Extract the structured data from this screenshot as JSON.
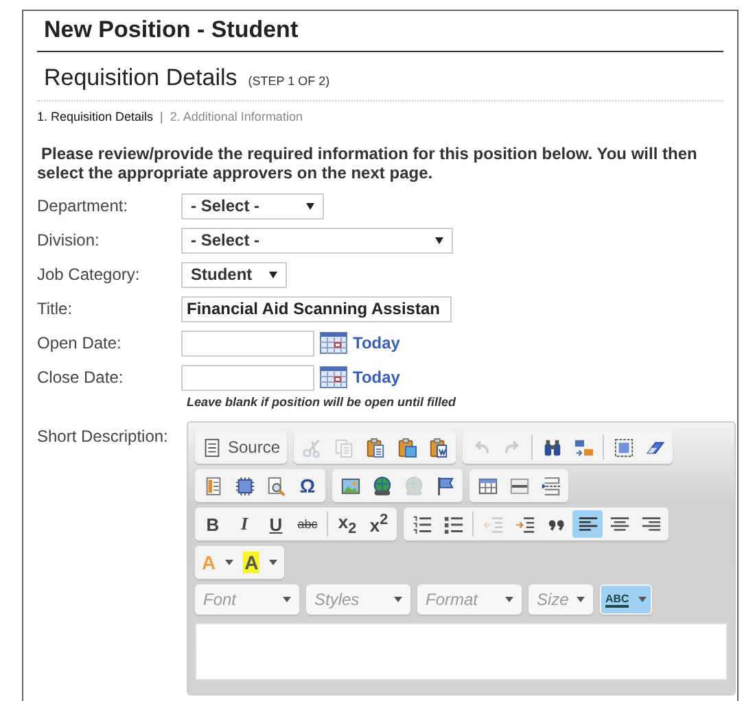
{
  "page_title": "New Position - Student",
  "section": {
    "title": "Requisition Details",
    "step": "(STEP 1 OF 2)"
  },
  "steps": [
    {
      "label": "1. Requisition Details",
      "selected": true
    },
    {
      "label": "2. Additional Information",
      "selected": false
    }
  ],
  "step_separator": "|",
  "instructions": "Please review/provide the required information for this position below. You will then select the appropriate approvers on the next page.",
  "fields": [
    {
      "kind": "select",
      "label": "Department:",
      "value": "- Select -"
    },
    {
      "kind": "select",
      "label": "Division:",
      "value": "- Select -"
    },
    {
      "kind": "select",
      "label": "Job Category:",
      "value": "Student"
    },
    {
      "kind": "text",
      "label": "Title:",
      "value": "Financial Aid Scanning Assistan"
    },
    {
      "kind": "date",
      "label": "Open Date:",
      "link": "Today"
    },
    {
      "kind": "date",
      "label": "Close Date:",
      "link": "Today",
      "hint": "Leave blank if position will be open until filled"
    }
  ],
  "editor_label": "Short Description:",
  "toolbar": [
    [
      [
        {
          "kind": "button",
          "label": "Source",
          "disabled": false,
          "selected": false
        }
      ],
      [
        {
          "kind": "button",
          "disabled": true,
          "selected": false
        },
        {
          "kind": "button",
          "disabled": true,
          "selected": false
        },
        {
          "kind": "button",
          "disabled": false,
          "selected": false
        },
        {
          "kind": "button",
          "disabled": false,
          "selected": false
        },
        {
          "kind": "button",
          "disabled": false,
          "selected": false
        }
      ],
      [
        {
          "kind": "button",
          "disabled": true,
          "selected": false
        },
        {
          "kind": "button",
          "disabled": true,
          "selected": false
        },
        {
          "kind": "button",
          "disabled": false,
          "selected": false,
          "divider": true
        },
        {
          "kind": "button",
          "disabled": false,
          "selected": false
        },
        {
          "kind": "button",
          "disabled": false,
          "selected": false,
          "divider": true
        },
        {
          "kind": "button",
          "disabled": false,
          "selected": false
        }
      ]
    ],
    [
      [
        {
          "kind": "button",
          "disabled": false,
          "selected": false
        },
        {
          "kind": "button",
          "disabled": false,
          "selected": false
        },
        {
          "kind": "button",
          "disabled": false,
          "selected": false
        },
        {
          "kind": "button",
          "label": "Ω",
          "disabled": false,
          "selected": false
        }
      ],
      [
        {
          "kind": "button",
          "disabled": false,
          "selected": false
        },
        {
          "kind": "button",
          "disabled": false,
          "selected": false
        },
        {
          "kind": "button",
          "disabled": true,
          "selected": false
        },
        {
          "kind": "button",
          "disabled": false,
          "selected": false
        }
      ],
      [
        {
          "kind": "button",
          "disabled": false,
          "selected": false
        },
        {
          "kind": "button",
          "disabled": false,
          "selected": false
        },
        {
          "kind": "button",
          "disabled": false,
          "selected": false
        }
      ]
    ],
    [
      [
        {
          "kind": "button",
          "label": "B",
          "disabled": false,
          "selected": false
        },
        {
          "kind": "button",
          "label": "I",
          "disabled": false,
          "selected": false
        },
        {
          "kind": "button",
          "label": "U",
          "disabled": false,
          "selected": false
        },
        {
          "kind": "button",
          "label": "abc",
          "disabled": false,
          "selected": false
        },
        {
          "kind": "button",
          "label": "x$_{2}$",
          "disabled": false,
          "selected": false,
          "divider": true
        },
        {
          "kind": "button",
          "label": "x$^{2}$",
          "disabled": false,
          "selected": false
        }
      ],
      [
        {
          "kind": "button",
          "disabled": false,
          "selected": false
        },
        {
          "kind": "button",
          "disabled": false,
          "selected": false
        },
        {
          "kind": "button",
          "disabled": true,
          "selected": false,
          "divider": true
        },
        {
          "kind": "button",
          "disabled": false,
          "selected": false
        },
        {
          "kind": "button",
          "disabled": false,
          "selected": false
        },
        {
          "kind": "button",
          "disabled": false,
          "selected": true
        },
        {
          "kind": "button",
          "disabled": false,
          "selected": false
        },
        {
          "kind": "button",
          "disabled": false,
          "selected": false
        }
      ]
    ],
    [
      [
        {
          "kind": "menu",
          "label": "A",
          "disabled": false,
          "selected": false
        },
        {
          "kind": "menu",
          "label": "A",
          "disabled": false,
          "selected": false
        }
      ]
    ],
    [
      [
        {
          "kind": "combo",
          "placeholder": "Font"
        }
      ],
      [
        {
          "kind": "combo",
          "placeholder": "Styles"
        }
      ],
      [
        {
          "kind": "combo",
          "placeholder": "Format"
        }
      ],
      [
        {
          "kind": "combo",
          "placeholder": "Size"
        }
      ],
      [
        {
          "kind": "menu",
          "label": "ABC",
          "disabled": false,
          "selected": true
        }
      ]
    ]
  ]
}
